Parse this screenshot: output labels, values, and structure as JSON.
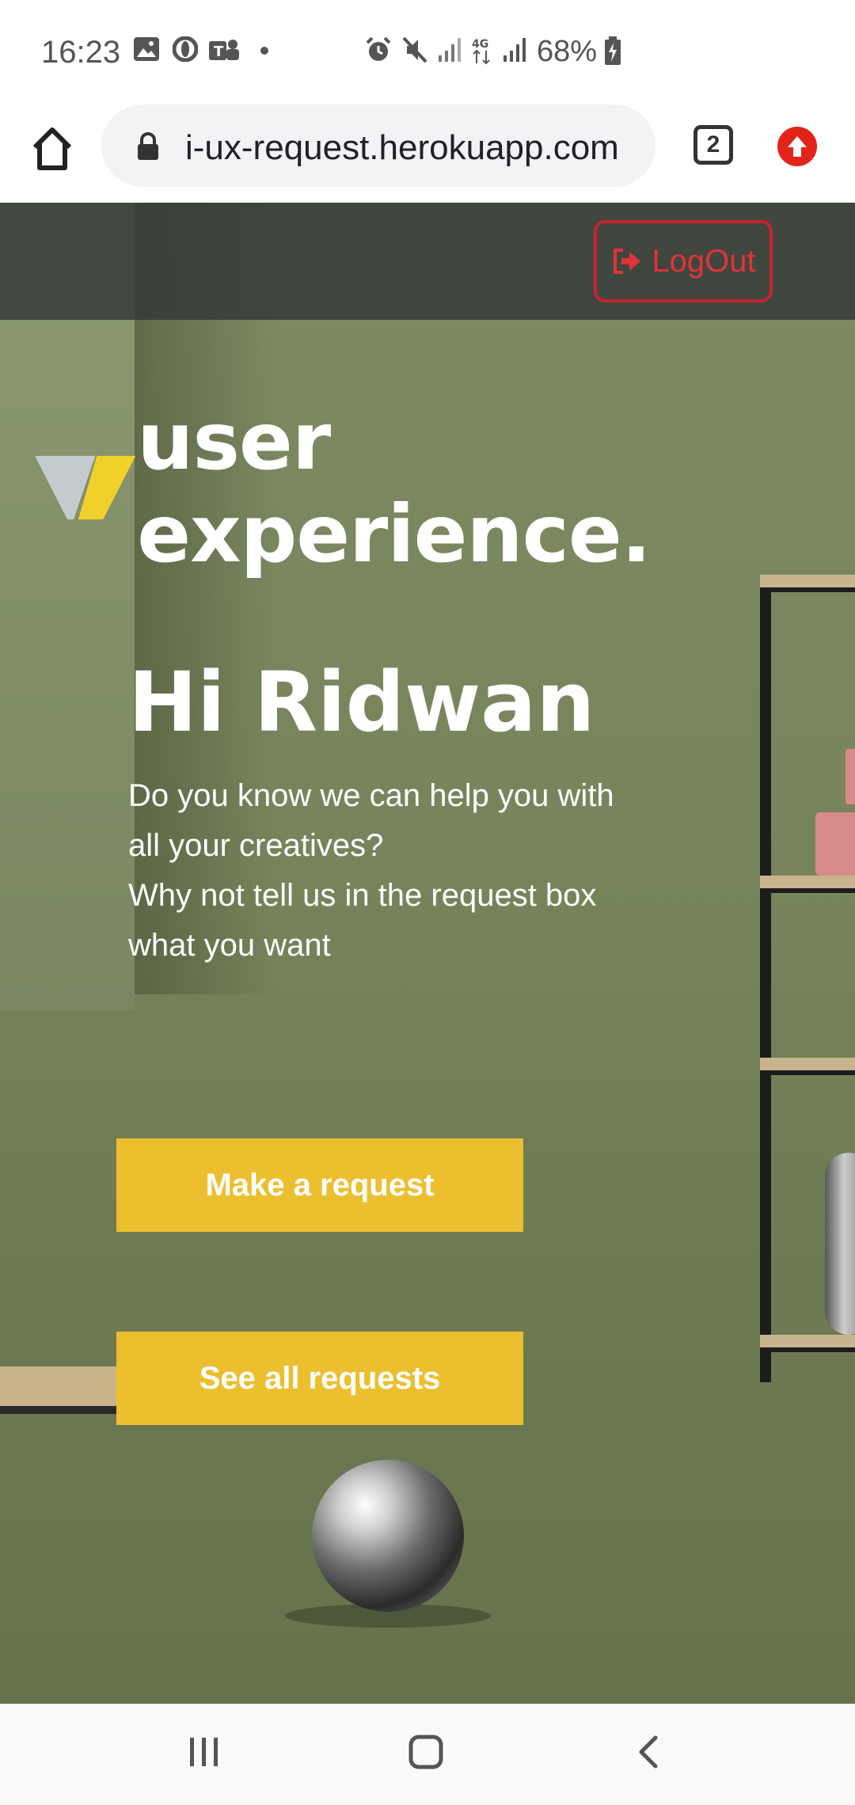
{
  "status_bar": {
    "time": "16:23",
    "battery": "68%",
    "icons": [
      "gallery-icon",
      "opera-icon",
      "teams-icon",
      "dot-icon",
      "alarm-icon",
      "mute-icon",
      "signal-icon",
      "4g-icon",
      "signal-icon",
      "battery-charging-icon"
    ]
  },
  "browser": {
    "url": "i-ux-request.herokuapp.com",
    "tab_count": "2",
    "icons": [
      "home-icon",
      "lock-icon",
      "tabs-icon",
      "update-icon"
    ]
  },
  "header": {
    "logout_label": "LogOut",
    "logout_icon": "logout-icon",
    "logout_color": "#e0323b"
  },
  "hero": {
    "brand_text": "user experience.",
    "greeting": "Hi Ridwan",
    "intro_lines": [
      "Do you know we can help you with",
      "all your creatives?",
      "Why not tell us in the request box",
      "what you want"
    ]
  },
  "actions": {
    "make_request": "Make a request",
    "see_all": "See all requests",
    "button_color": "#ecbf2f"
  },
  "nav_bar": {
    "icons": [
      "recent-apps-icon",
      "home-nav-icon",
      "back-icon"
    ]
  }
}
